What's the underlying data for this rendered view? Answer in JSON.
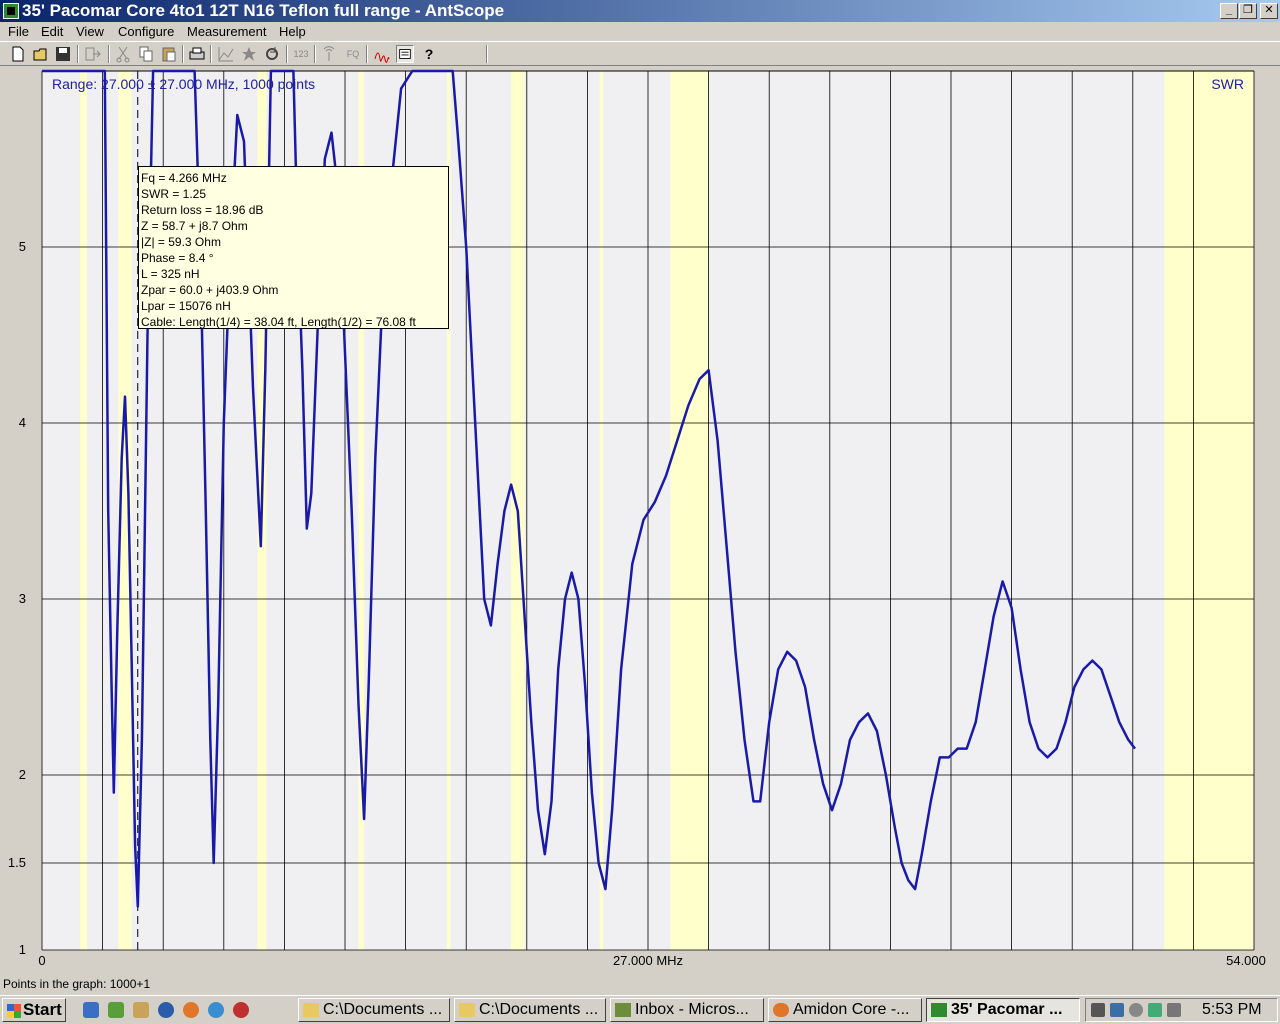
{
  "window": {
    "title": "35' Pacomar Core 4to1 12T N16 Teflon full range - AntScope",
    "buttons": {
      "minimize": "_",
      "maximize": "❐",
      "close": "✕"
    }
  },
  "menu": [
    {
      "label": "File",
      "id": "file"
    },
    {
      "label": "Edit",
      "id": "edit"
    },
    {
      "label": "View",
      "id": "view"
    },
    {
      "label": "Configure",
      "id": "configure"
    },
    {
      "label": "Measurement",
      "id": "measurement"
    },
    {
      "label": "Help",
      "id": "help"
    }
  ],
  "toolbar": {
    "icons": [
      "new-file-icon",
      "open-folder-icon",
      "save-icon",
      "export-icon",
      "cut-icon",
      "copy-icon",
      "paste-icon",
      "print-icon",
      "chart-icon",
      "star-icon",
      "refresh-icon",
      "counter-icon",
      "antenna-icon",
      "fq-icon",
      "sweep-icon",
      "tooltip-icon",
      "help-icon"
    ],
    "counter_label": "123",
    "fq_label": "FQ"
  },
  "chart_data": {
    "type": "line",
    "range_label": "Range: 27.000 ± 27.000 MHz, 1000 points",
    "series_label": "SWR",
    "x_range": [
      0,
      54
    ],
    "y_range": [
      1,
      6
    ],
    "x_tick_labels": [
      "0",
      "27.000 MHz",
      "54.000"
    ],
    "y_ticks": [
      {
        "value": 1,
        "label": "1"
      },
      {
        "value": 1.5,
        "label": "1.5"
      },
      {
        "value": 2,
        "label": "2"
      },
      {
        "value": 3,
        "label": "3"
      },
      {
        "value": 4,
        "label": "4"
      },
      {
        "value": 5,
        "label": "5"
      }
    ],
    "cursor_x": 4.266,
    "highlight_bands": [
      [
        1.7,
        2.0
      ],
      [
        3.4,
        4.0
      ],
      [
        9.6,
        10.0
      ],
      [
        14.1,
        14.35
      ],
      [
        18.05,
        18.2
      ],
      [
        20.9,
        21.5
      ],
      [
        24.85,
        25.0
      ],
      [
        28.0,
        29.7
      ],
      [
        50.0,
        54.0
      ]
    ],
    "points": [
      [
        0,
        6
      ],
      [
        2.8,
        6
      ],
      [
        2.95,
        3.5
      ],
      [
        3.1,
        2.5
      ],
      [
        3.2,
        1.9
      ],
      [
        3.35,
        2.8
      ],
      [
        3.55,
        3.8
      ],
      [
        3.7,
        4.15
      ],
      [
        3.85,
        3.6
      ],
      [
        4.0,
        2.6
      ],
      [
        4.15,
        1.6
      ],
      [
        4.27,
        1.25
      ],
      [
        4.45,
        2.2
      ],
      [
        4.7,
        4.5
      ],
      [
        4.95,
        6
      ],
      [
        6.8,
        6
      ],
      [
        7.05,
        5.0
      ],
      [
        7.3,
        3.5
      ],
      [
        7.5,
        2.2
      ],
      [
        7.65,
        1.5
      ],
      [
        7.85,
        2.4
      ],
      [
        8.1,
        4.0
      ],
      [
        8.4,
        5.0
      ],
      [
        8.7,
        5.75
      ],
      [
        9.0,
        5.6
      ],
      [
        9.4,
        4.2
      ],
      [
        9.75,
        3.3
      ],
      [
        9.95,
        4.3
      ],
      [
        10.2,
        6
      ],
      [
        11.2,
        6
      ],
      [
        11.4,
        5.0
      ],
      [
        11.6,
        4.3
      ],
      [
        11.8,
        3.4
      ],
      [
        12.0,
        3.6
      ],
      [
        12.3,
        4.6
      ],
      [
        12.6,
        5.5
      ],
      [
        12.9,
        5.65
      ],
      [
        13.2,
        5.3
      ],
      [
        13.5,
        4.4
      ],
      [
        13.8,
        3.5
      ],
      [
        14.1,
        2.4
      ],
      [
        14.35,
        1.75
      ],
      [
        14.55,
        2.5
      ],
      [
        14.85,
        3.8
      ],
      [
        15.2,
        4.8
      ],
      [
        15.6,
        5.4
      ],
      [
        16.0,
        5.9
      ],
      [
        16.5,
        6
      ],
      [
        18.3,
        6
      ],
      [
        18.55,
        5.6
      ],
      [
        18.9,
        5.0
      ],
      [
        19.3,
        4.0
      ],
      [
        19.7,
        3.0
      ],
      [
        20.0,
        2.85
      ],
      [
        20.3,
        3.2
      ],
      [
        20.6,
        3.5
      ],
      [
        20.9,
        3.65
      ],
      [
        21.2,
        3.5
      ],
      [
        21.5,
        2.9
      ],
      [
        21.8,
        2.3
      ],
      [
        22.1,
        1.8
      ],
      [
        22.4,
        1.55
      ],
      [
        22.7,
        1.85
      ],
      [
        23.0,
        2.6
      ],
      [
        23.3,
        3.0
      ],
      [
        23.6,
        3.15
      ],
      [
        23.9,
        3.0
      ],
      [
        24.2,
        2.5
      ],
      [
        24.5,
        1.9
      ],
      [
        24.8,
        1.5
      ],
      [
        25.1,
        1.35
      ],
      [
        25.4,
        1.8
      ],
      [
        25.8,
        2.6
      ],
      [
        26.3,
        3.2
      ],
      [
        26.8,
        3.45
      ],
      [
        27.3,
        3.55
      ],
      [
        27.8,
        3.7
      ],
      [
        28.3,
        3.9
      ],
      [
        28.8,
        4.1
      ],
      [
        29.3,
        4.25
      ],
      [
        29.7,
        4.3
      ],
      [
        30.1,
        3.9
      ],
      [
        30.5,
        3.3
      ],
      [
        30.9,
        2.7
      ],
      [
        31.3,
        2.2
      ],
      [
        31.7,
        1.85
      ],
      [
        32.0,
        1.85
      ],
      [
        32.4,
        2.3
      ],
      [
        32.8,
        2.6
      ],
      [
        33.2,
        2.7
      ],
      [
        33.6,
        2.65
      ],
      [
        34.0,
        2.5
      ],
      [
        34.4,
        2.2
      ],
      [
        34.8,
        1.95
      ],
      [
        35.2,
        1.8
      ],
      [
        35.6,
        1.95
      ],
      [
        36.0,
        2.2
      ],
      [
        36.4,
        2.3
      ],
      [
        36.8,
        2.35
      ],
      [
        37.2,
        2.25
      ],
      [
        37.6,
        2.0
      ],
      [
        38.0,
        1.7
      ],
      [
        38.3,
        1.5
      ],
      [
        38.6,
        1.4
      ],
      [
        38.9,
        1.35
      ],
      [
        39.2,
        1.55
      ],
      [
        39.6,
        1.85
      ],
      [
        40.0,
        2.1
      ],
      [
        40.4,
        2.1
      ],
      [
        40.8,
        2.15
      ],
      [
        41.2,
        2.15
      ],
      [
        41.6,
        2.3
      ],
      [
        42.0,
        2.6
      ],
      [
        42.4,
        2.9
      ],
      [
        42.8,
        3.1
      ],
      [
        43.2,
        2.95
      ],
      [
        43.6,
        2.6
      ],
      [
        44.0,
        2.3
      ],
      [
        44.4,
        2.15
      ],
      [
        44.8,
        2.1
      ],
      [
        45.2,
        2.15
      ],
      [
        45.6,
        2.3
      ],
      [
        46.0,
        2.5
      ],
      [
        46.4,
        2.6
      ],
      [
        46.8,
        2.65
      ],
      [
        47.2,
        2.6
      ],
      [
        47.6,
        2.45
      ],
      [
        48.0,
        2.3
      ],
      [
        48.4,
        2.2
      ],
      [
        48.7,
        2.15
      ]
    ]
  },
  "tooltip": {
    "lines": [
      "Fq = 4.266 MHz",
      "SWR = 1.25",
      "Return loss = 18.96 dB",
      "Z = 58.7 + j8.7 Ohm",
      "|Z| = 59.3 Ohm",
      "Phase = 8.4 °",
      "L = 325 nH",
      "Zpar = 60.0 + j403.9 Ohm",
      "Lpar = 15076 nH",
      "Cable: Length(1/4) = 38.04 ft, Length(1/2) = 76.08 ft"
    ]
  },
  "status": {
    "text": "Points in the graph: 1000+1"
  },
  "taskbar": {
    "start_label": "Start",
    "tasks": [
      {
        "label": "C:\\Documents ...",
        "icon": "folder-icon",
        "active": false
      },
      {
        "label": "C:\\Documents ...",
        "icon": "folder-icon",
        "active": false
      },
      {
        "label": "Inbox - Micros...",
        "icon": "outlook-icon",
        "active": false
      },
      {
        "label": "Amidon Core -...",
        "icon": "firefox-icon",
        "active": false
      },
      {
        "label": "35' Pacomar ...",
        "icon": "antscope-icon",
        "active": true
      }
    ],
    "clock": "5:53 PM"
  },
  "colors": {
    "curve": "#1a1aa8",
    "plot_bg": "#f0f0f2",
    "band": "#ffffcc",
    "grid": "#000000",
    "label": "#2020a0"
  }
}
